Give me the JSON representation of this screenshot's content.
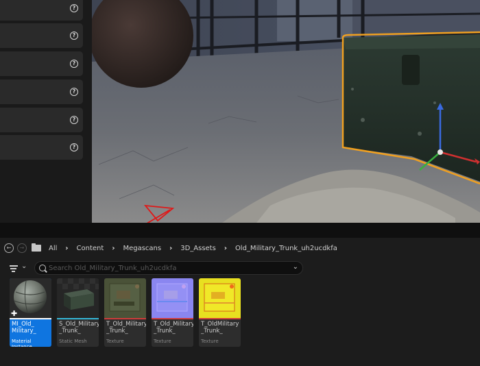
{
  "left_panel": {
    "rows": [
      {
        "icon": "help-icon",
        "glyph": "?"
      },
      {
        "icon": "help-icon",
        "glyph": "?"
      },
      {
        "icon": "help-icon",
        "glyph": "?"
      },
      {
        "icon": "help-icon",
        "glyph": "?"
      },
      {
        "icon": "help-icon",
        "glyph": "?"
      },
      {
        "icon": "help-icon",
        "glyph": "?"
      }
    ]
  },
  "path": {
    "back_glyph": "←",
    "forward_glyph": "→",
    "crumbs": [
      "All",
      "Content",
      "Megascans",
      "3D_Assets",
      "Old_Military_Trunk_uh2ucdkfa"
    ],
    "separator": "›"
  },
  "search": {
    "placeholder": "Search Old_Military_Trunk_uh2ucdkfa",
    "value": "",
    "chevron": "⌄"
  },
  "filter": {
    "chevron": "⌄"
  },
  "assets": [
    {
      "name": "MI_Old_\nMilitary_",
      "type": "Material Instance",
      "type_color": "#ffffff",
      "selected": true
    },
    {
      "name": "S_Old_Military\n_Trunk_",
      "type": "Static Mesh",
      "type_color": "#35b8d8",
      "selected": false
    },
    {
      "name": "T_Old_Military\n_Trunk_",
      "type": "Texture",
      "type_color": "#cf3a3a",
      "selected": false
    },
    {
      "name": "T_Old_Military\n_Trunk_",
      "type": "Texture",
      "type_color": "#cf3a3a",
      "selected": false
    },
    {
      "name": "T_OldMilitary\n_Trunk_",
      "type": "Texture",
      "type_color": "#cf3a3a",
      "selected": false
    }
  ],
  "colors": {
    "accent_selection": "#0f75e0",
    "gizmo_outline": "#f0a020",
    "annotation_arrow": "#e01818"
  }
}
